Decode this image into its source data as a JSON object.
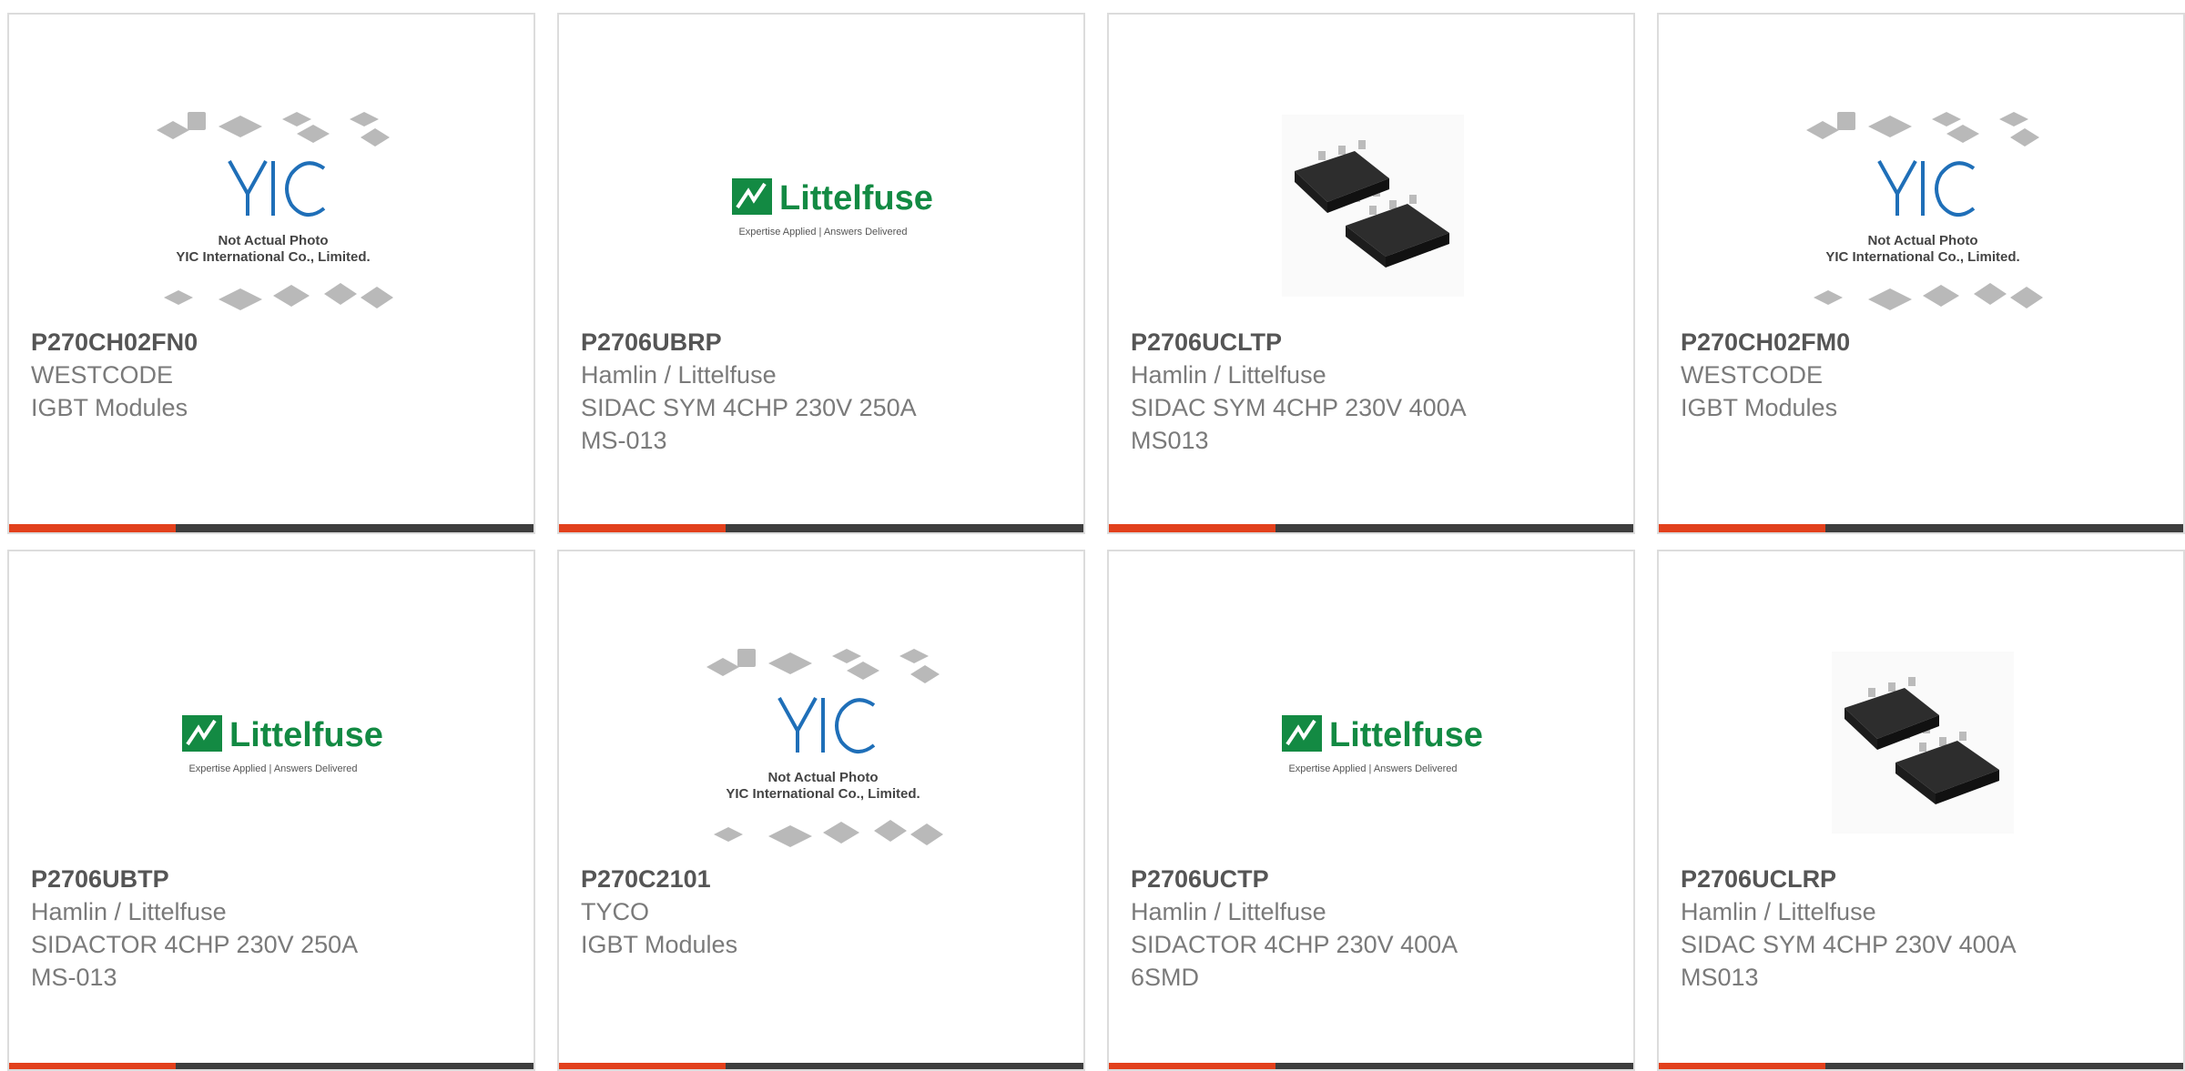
{
  "colors": {
    "accent": "#e2401c",
    "bar": "#3d3d3d",
    "littelfuse_green": "#138a43",
    "yic_blue": "#1f6fb8"
  },
  "placeholder_logo": {
    "brand": "YIC",
    "line1": "Not Actual Photo",
    "line2": "YIC International Co., Limited."
  },
  "littelfuse_logo": {
    "brand": "Littelfuse",
    "tagline": "Expertise Applied | Answers Delivered"
  },
  "products": [
    {
      "part_number": "P270CH02FN0",
      "lines": [
        "WESTCODE",
        "IGBT Modules"
      ],
      "image": "yic-placeholder"
    },
    {
      "part_number": "P2706UBRP",
      "lines": [
        "Hamlin / Littelfuse",
        "SIDAC SYM 4CHP 230V 250A",
        "MS-013"
      ],
      "image": "littelfuse-logo"
    },
    {
      "part_number": "P2706UCLTP",
      "lines": [
        "Hamlin / Littelfuse",
        "SIDAC SYM 4CHP 230V 400A",
        "MS013"
      ],
      "image": "chip-photo"
    },
    {
      "part_number": "P270CH02FM0",
      "lines": [
        "WESTCODE",
        "IGBT Modules"
      ],
      "image": "yic-placeholder"
    },
    {
      "part_number": "P2706UBTP",
      "lines": [
        "Hamlin / Littelfuse",
        "SIDACTOR 4CHP 230V 250A",
        "MS-013"
      ],
      "image": "littelfuse-logo"
    },
    {
      "part_number": "P270C2101",
      "lines": [
        "TYCO",
        "IGBT Modules"
      ],
      "image": "yic-placeholder"
    },
    {
      "part_number": "P2706UCTP",
      "lines": [
        "Hamlin / Littelfuse",
        "SIDACTOR 4CHP 230V 400A",
        "6SMD"
      ],
      "image": "littelfuse-logo"
    },
    {
      "part_number": "P2706UCLRP",
      "lines": [
        "Hamlin / Littelfuse",
        "SIDAC SYM 4CHP 230V 400A",
        "MS013"
      ],
      "image": "chip-photo"
    }
  ]
}
